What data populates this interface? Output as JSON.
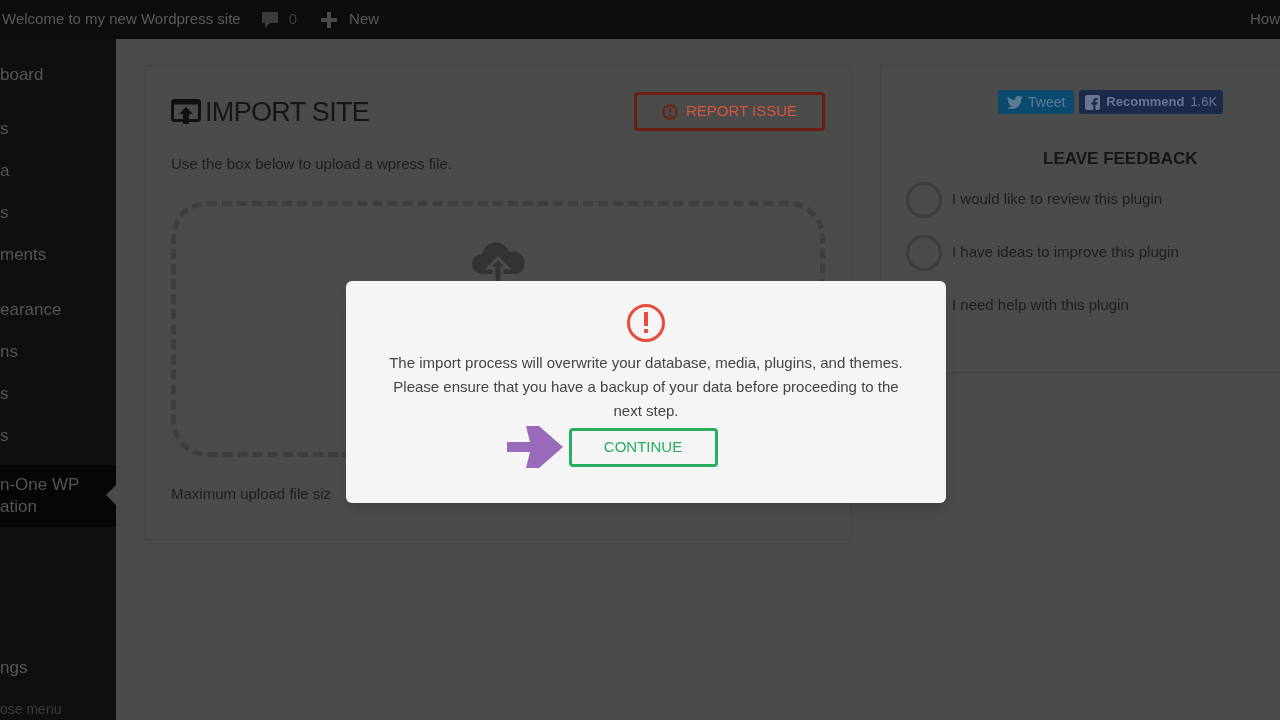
{
  "topbar": {
    "site_title": "Welcome to my new Wordpress site",
    "comments_count": "0",
    "new_label": "New",
    "right_text": "How"
  },
  "sidebar": {
    "items": [
      {
        "label": "board",
        "selected": false
      },
      {
        "label": "s",
        "selected": false
      },
      {
        "label": "a",
        "selected": false
      },
      {
        "label": "s",
        "selected": false
      },
      {
        "label": "ments",
        "selected": false
      },
      {
        "label": "earance",
        "selected": false
      },
      {
        "label": "ns",
        "selected": false
      },
      {
        "label": "s",
        "selected": false
      },
      {
        "label": "s",
        "selected": false
      },
      {
        "label": "n-One WP\nation",
        "selected": true
      },
      {
        "label": "ngs",
        "selected": false
      }
    ],
    "collapse_label": "ose menu"
  },
  "import_card": {
    "title": "IMPORT SITE",
    "report_button": "REPORT ISSUE",
    "instructions": "Use the box below to upload a wpress file.",
    "max_upload": "Maximum upload file siz"
  },
  "feedback_card": {
    "tweet_button": "Tweet",
    "recommend_button": "Recommend",
    "recommend_count": "1.6K",
    "heading": "LEAVE FEEDBACK",
    "options": [
      {
        "label": "I would like to review this plugin",
        "selected": false
      },
      {
        "label": "I have ideas to improve this plugin",
        "selected": false
      },
      {
        "label": "I need help with this plugin"
      }
    ]
  },
  "modal": {
    "message": "The import process will overwrite your database, media, plugins, and themes. Please ensure that you have a backup of your data before proceeding to the next step.",
    "continue_button": "CONTINUE"
  }
}
